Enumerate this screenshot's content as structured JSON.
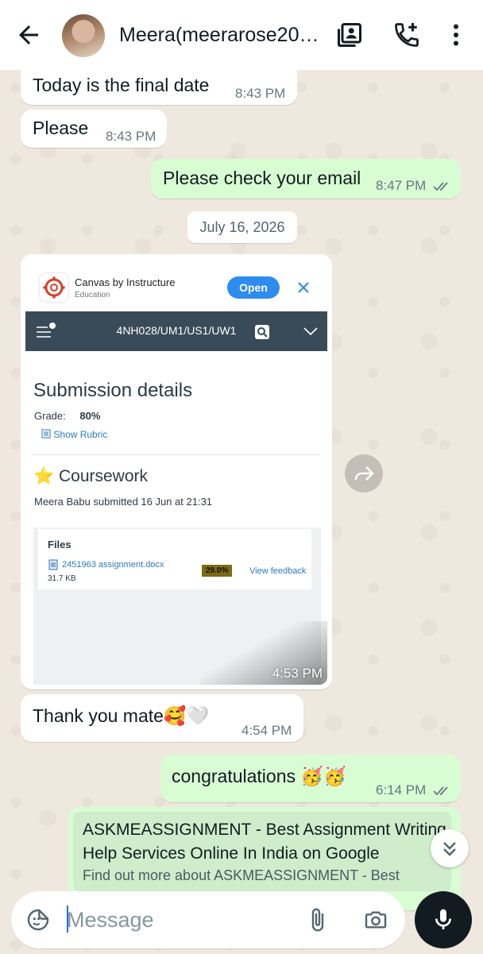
{
  "header": {
    "contact_name": "Meera(meerarose20…",
    "icons": [
      "back-arrow-icon",
      "contact-card-icon",
      "add-call-icon",
      "more-vert-icon"
    ]
  },
  "messages": [
    {
      "direction": "in",
      "text": "Today is the final date",
      "time": "8:43 PM"
    },
    {
      "direction": "in",
      "text": "Please",
      "time": "8:43 PM"
    },
    {
      "direction": "out",
      "text": "Please check your email",
      "time": "8:47 PM",
      "status": "read"
    },
    {
      "direction": "in",
      "type": "image",
      "time": "4:53 PM"
    },
    {
      "direction": "in",
      "text": "Thank you mate🥰🤍",
      "time": "4:54 PM"
    },
    {
      "direction": "out",
      "text": "congratulations 🥳🥳",
      "time": "6:14 PM",
      "status": "read"
    }
  ],
  "date_separator": "July 16, 2026",
  "image_content": {
    "app_name": "Canvas by Instructure",
    "app_category": "Education",
    "open_label": "Open",
    "course_code": "4NH028/UM1/US1/UW1",
    "heading": "Submission details",
    "grade_label": "Grade:",
    "grade_value": "80%",
    "rubric_link": "Show Rubric",
    "coursework_title": "⭐ Coursework",
    "submitted_line": "Meera Babu submitted 16 Jun at 21:31",
    "files_label": "Files",
    "file_name": "2451963 assignment.docx",
    "file_size": "31.7 KB",
    "similarity_score": "29.0%",
    "view_feedback": "View feedback"
  },
  "link_preview": {
    "title": "ASKMEASSIGNMENT - Best Assignment Writing Help Services Online In India on Google",
    "description": "Find out more about ASKMEASSIGNMENT - Best"
  },
  "composer": {
    "placeholder": "Message"
  },
  "colors": {
    "outgoing_bubble": "#d9fdd3",
    "incoming_bubble": "#ffffff",
    "wallpaper": "#efe8df",
    "read_tick": "#667781"
  }
}
